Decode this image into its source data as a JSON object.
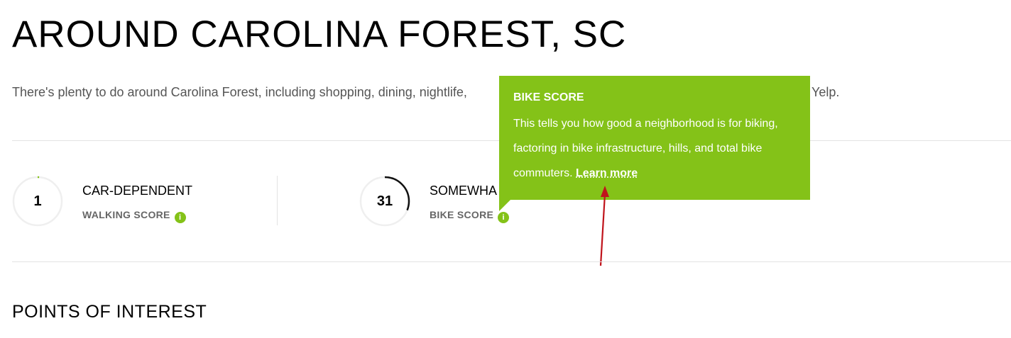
{
  "page_title": "AROUND CAROLINA FOREST, SC",
  "intro_text": "There's plenty to do around Carolina Forest, including shopping, dining, nightlife,",
  "intro_tail": "Yelp.",
  "scores": [
    {
      "value": "1",
      "fraction": 0.01,
      "label": "CAR-DEPENDENT",
      "type": "WALKING SCORE"
    },
    {
      "value": "31",
      "fraction": 0.31,
      "label": "SOMEWHA",
      "type": "BIKE SCORE"
    }
  ],
  "info_icon_glyph": "i",
  "tooltip": {
    "title": "BIKE SCORE",
    "body": "This tells you how good a neighborhood is for biking, factoring in bike infrastructure, hills, and total bike commuters.",
    "link": "Learn more"
  },
  "section_title": "POINTS OF INTEREST",
  "colors": {
    "accent": "#84c218",
    "annotation_arrow": "#c0141c",
    "ring_track": "#efefef",
    "ring_progress": "#111111"
  }
}
